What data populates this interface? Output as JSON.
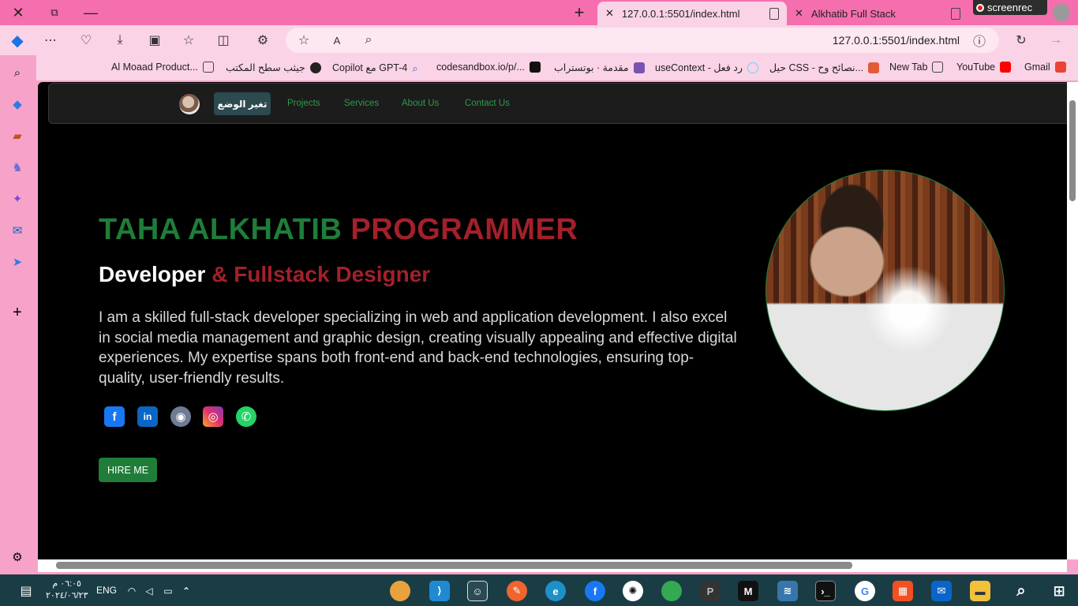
{
  "browser": {
    "tabs": [
      {
        "title": "127.0.0.1:5501/index.html",
        "active": true
      },
      {
        "title": "Alkhatib Full Stack",
        "active": false
      }
    ],
    "screenrec_label": "screenrec",
    "address_url": "127.0.0.1:5501/index.html",
    "bookmarks": [
      "Gmail",
      "YouTube",
      "New Tab",
      "حيل CSS - نصائح وح...",
      "useContext - رد فعل",
      "مقدمة · بوتستراب",
      "codesandbox.io/p/...",
      "Copilot مع GPT-4",
      "جيثب سطح المكتب",
      "Al Moaad Product..."
    ]
  },
  "site": {
    "nav": {
      "mode_button": "تغير الوضع",
      "links": [
        "Projects",
        "Services",
        "About Us",
        "Contact Us"
      ]
    },
    "hero": {
      "title_green": "TAHA ALKHATIB",
      "title_red": "PROGRAMMER",
      "sub_white": "Developer",
      "sub_red": "& Fullstack Designer",
      "description": "I am a skilled full-stack developer specializing in web and application development. I also excel in social media management and graphic design, creating visually appealing and effective digital experiences. My expertise spans both front-end and back-end technologies, ensuring top-quality, user-friendly results.",
      "hire_button": "HIRE ME"
    },
    "social_icons": [
      "facebook-icon",
      "linkedin-icon",
      "github-icon",
      "instagram-icon",
      "whatsapp-icon"
    ]
  },
  "taskbar": {
    "language": "ENG",
    "time": "٠٦:٠٥ م",
    "date": "٢٠٢٤/٠٦/٢٣"
  },
  "colors": {
    "accent_green": "#1f7d39",
    "accent_red": "#a3202a",
    "browser_pink": "#f56fae"
  }
}
